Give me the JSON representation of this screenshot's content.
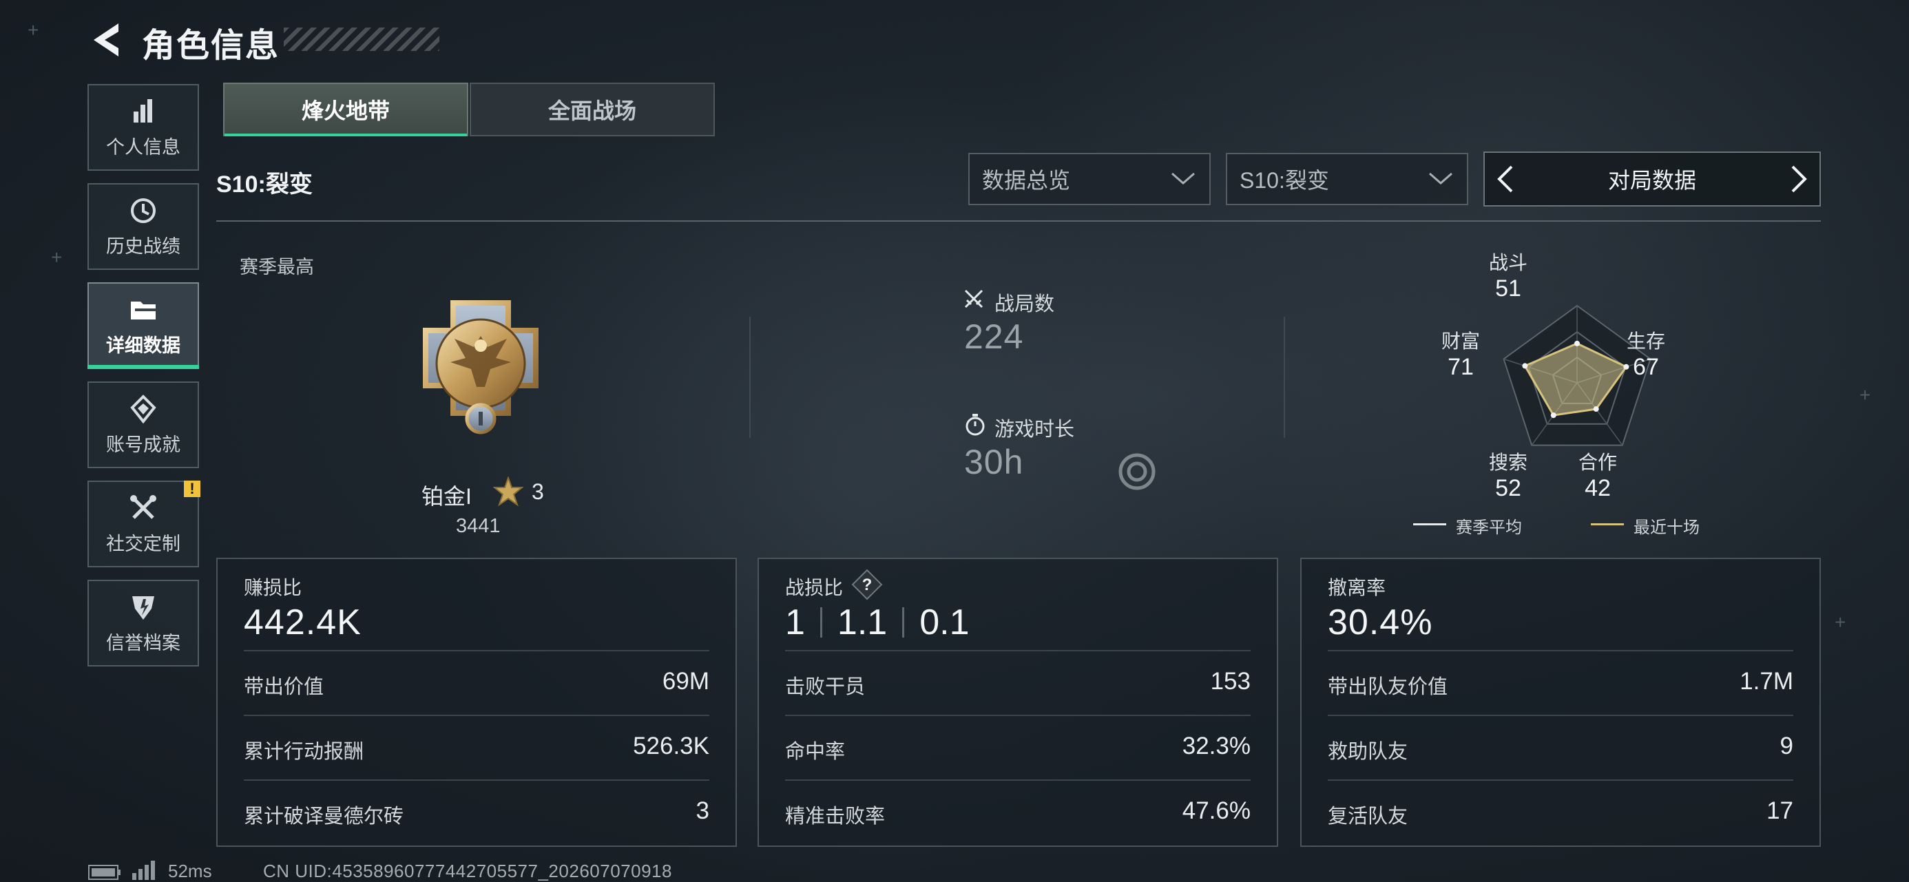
{
  "header": {
    "title": "角色信息"
  },
  "sidebar": {
    "items": [
      {
        "label": "个人信息",
        "icon": "bar-chart-icon"
      },
      {
        "label": "历史战绩",
        "icon": "history-icon"
      },
      {
        "label": "详细数据",
        "icon": "folder-icon",
        "active": true
      },
      {
        "label": "账号成就",
        "icon": "achievement-icon"
      },
      {
        "label": "社交定制",
        "icon": "tools-icon",
        "badge": "!"
      },
      {
        "label": "信誉档案",
        "icon": "credit-shield-icon"
      }
    ]
  },
  "mode_tabs": [
    {
      "label": "烽火地带",
      "selected": true
    },
    {
      "label": "全面战场",
      "selected": false
    }
  ],
  "season_label": "S10:裂变",
  "filters": {
    "overview": "数据总览",
    "season": "S10:裂变",
    "pager": "对局数据"
  },
  "rank": {
    "caption": "赛季最高",
    "name": "铂金I",
    "stars": "3",
    "points": "3441"
  },
  "summary": {
    "matches_label": "战局数",
    "matches_value": "224",
    "playtime_label": "游戏时长",
    "playtime_value": "30h"
  },
  "radar": {
    "axes": [
      {
        "label": "战斗",
        "value": 51
      },
      {
        "label": "生存",
        "value": 67
      },
      {
        "label": "合作",
        "value": 42
      },
      {
        "label": "搜索",
        "value": 52
      },
      {
        "label": "财富",
        "value": 71
      }
    ],
    "legend_avg": "赛季平均",
    "legend_recent": "最近十场",
    "recent_color": "#d8c37d",
    "avg_color": "#e8ecee"
  },
  "cards": {
    "profit": {
      "title": "赚损比",
      "value": "442.4K",
      "rows": [
        {
          "label": "带出价值",
          "value": "69M"
        },
        {
          "label": "累计行动报酬",
          "value": "526.3K"
        },
        {
          "label": "累计破译曼德尔砖",
          "value": "3"
        }
      ]
    },
    "kd": {
      "title": "战损比",
      "help": "?",
      "values": [
        "1",
        "1.1",
        "0.1"
      ],
      "rows": [
        {
          "label": "击败干员",
          "value": "153"
        },
        {
          "label": "命中率",
          "value": "32.3%"
        },
        {
          "label": "精准击败率",
          "value": "47.6%"
        }
      ]
    },
    "extract": {
      "title": "撤离率",
      "value": "30.4%",
      "rows": [
        {
          "label": "带出队友价值",
          "value": "1.7M"
        },
        {
          "label": "救助队友",
          "value": "9"
        },
        {
          "label": "复活队友",
          "value": "17"
        }
      ]
    }
  },
  "footer": {
    "ping": "52ms",
    "uid": "CN UID:4535896077744270557​7_202607070918"
  }
}
